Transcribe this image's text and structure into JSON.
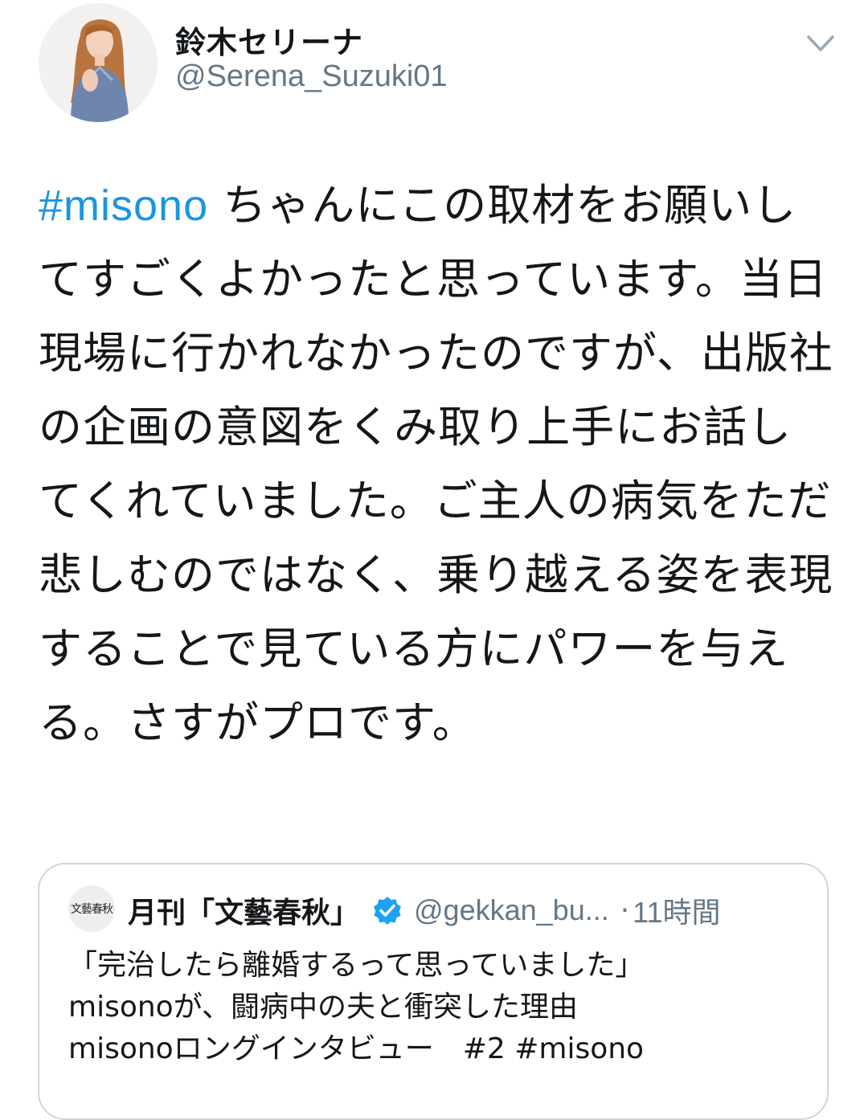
{
  "tweet": {
    "author": {
      "display_name": "鈴木セリーナ",
      "handle": "@Serena_Suzuki01",
      "avatar_icon": "user-avatar-photo"
    },
    "menu_icon": "chevron-down-icon",
    "hashtag": "#misono",
    "text": " ちゃんにこの取材をお願いしてすごくよかったと思っています。当日現場に行かれなかったのですが、出版社の企画の意図をくみ取り上手にお話してくれていました。ご主人の病気をただ悲しむのではなく、乗り越える姿を表現することで見ている方にパワーを与える。さすがプロです。"
  },
  "quoted_tweet": {
    "logo_text": "文藝春秋",
    "name": "月刊「文藝春秋」",
    "verified": true,
    "handle": "@gekkan_bu...",
    "separator": "·",
    "time": "11時間",
    "lines": [
      "「完治したら離婚するって思っていました」",
      "misonoが、闘病中の夫と衝突した理由",
      "misonoロングインタビュー　#2 #misono"
    ]
  },
  "colors": {
    "link": "#1b95e0",
    "text": "#14171a",
    "muted": "#657786",
    "border": "#ccd6dd",
    "verified": "#1da1f2"
  }
}
